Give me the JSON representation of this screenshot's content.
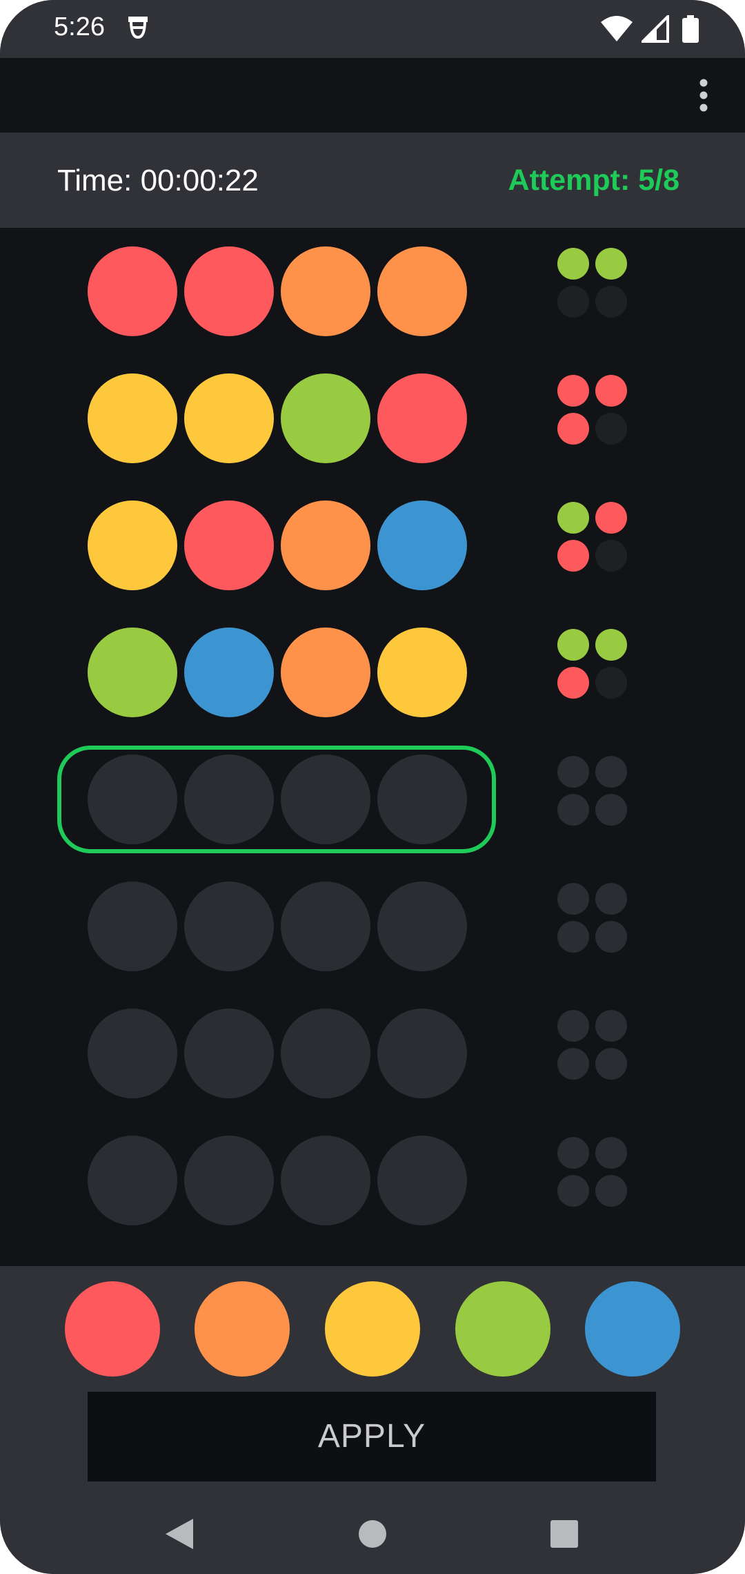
{
  "status_bar": {
    "time": "5:26",
    "icons": [
      "notification-app-icon",
      "wifi-icon",
      "signal-icon",
      "battery-icon"
    ]
  },
  "app_bar": {
    "menu_icon": "overflow-menu-icon"
  },
  "info": {
    "time_label": "Time: 00:00:22",
    "attempt_label": "Attempt: 5/8",
    "attempt_current": 5,
    "attempt_total": 8
  },
  "colors": {
    "red": "#fe5a5d",
    "orange": "#fe924a",
    "yellow": "#fec83c",
    "green": "#98cb42",
    "blue": "#3c95d0",
    "empty_peg": "#2c2d32",
    "empty_feedback": "#1f2024",
    "empty_feedback_pending": "#2c2d32",
    "active_highlight": "#1ecb58"
  },
  "board": {
    "active_row": 4,
    "rows": [
      {
        "pegs": [
          "red",
          "red",
          "orange",
          "orange"
        ],
        "feedback": [
          "green",
          "green",
          "none",
          "none"
        ]
      },
      {
        "pegs": [
          "yellow",
          "yellow",
          "green",
          "red"
        ],
        "feedback": [
          "red",
          "red",
          "red",
          "none"
        ]
      },
      {
        "pegs": [
          "yellow",
          "red",
          "orange",
          "blue"
        ],
        "feedback": [
          "green",
          "red",
          "red",
          "none"
        ]
      },
      {
        "pegs": [
          "green",
          "blue",
          "orange",
          "yellow"
        ],
        "feedback": [
          "green",
          "green",
          "red",
          "none"
        ]
      },
      {
        "pegs": [
          "empty",
          "empty",
          "empty",
          "empty"
        ],
        "feedback": [
          "pending",
          "pending",
          "pending",
          "pending"
        ]
      },
      {
        "pegs": [
          "empty",
          "empty",
          "empty",
          "empty"
        ],
        "feedback": [
          "pending",
          "pending",
          "pending",
          "pending"
        ]
      },
      {
        "pegs": [
          "empty",
          "empty",
          "empty",
          "empty"
        ],
        "feedback": [
          "pending",
          "pending",
          "pending",
          "pending"
        ]
      },
      {
        "pegs": [
          "empty",
          "empty",
          "empty",
          "empty"
        ],
        "feedback": [
          "pending",
          "pending",
          "pending",
          "pending"
        ]
      }
    ]
  },
  "palette": [
    "red",
    "orange",
    "yellow",
    "green",
    "blue"
  ],
  "apply_label": "APPLY",
  "nav": {
    "back_icon": "back-triangle-icon",
    "home_icon": "home-circle-icon",
    "recents_icon": "recents-square-icon"
  }
}
